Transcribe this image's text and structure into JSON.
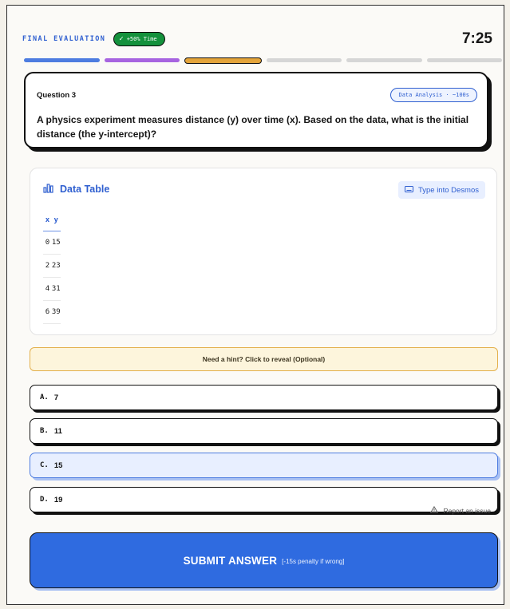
{
  "header": {
    "label": "FINAL EVALUATION",
    "bonus_check": "✓",
    "bonus_text": "+50% Time",
    "timer": "7:25"
  },
  "progress": {
    "segments": 6,
    "current": 3,
    "colors": [
      "#4d7ce0",
      "#a764e0",
      "#e4a43a",
      "#d6d6d6"
    ]
  },
  "question": {
    "number_label": "Question 3",
    "tag": "Data Analysis · ~100s",
    "text": "A physics experiment measures distance (y) over time (x). Based on the data, what is the initial distance (the y-intercept)?"
  },
  "data_table": {
    "title": "Data Table",
    "icon": "bar-chart-icon",
    "desmos_button": "Type into Desmos",
    "headers": [
      "x",
      "y"
    ],
    "rows": [
      [
        "0",
        "15"
      ],
      [
        "2",
        "23"
      ],
      [
        "4",
        "31"
      ],
      [
        "6",
        "39"
      ]
    ]
  },
  "hint": {
    "label": "Need a hint? Click to reveal (Optional)"
  },
  "options": [
    {
      "letter": "A.",
      "value": "7",
      "selected": false
    },
    {
      "letter": "B.",
      "value": "11",
      "selected": false
    },
    {
      "letter": "C.",
      "value": "15",
      "selected": true
    },
    {
      "letter": "D.",
      "value": "19",
      "selected": false
    }
  ],
  "report": {
    "icon": "warning-icon",
    "label": "Report an issue"
  },
  "submit": {
    "label": "SUBMIT ANSWER",
    "penalty": "[-15s penalty if wrong]"
  },
  "theme": {
    "accent": "#2f6be0",
    "success": "#14913c",
    "hint_bg": "#fdf5dc"
  }
}
